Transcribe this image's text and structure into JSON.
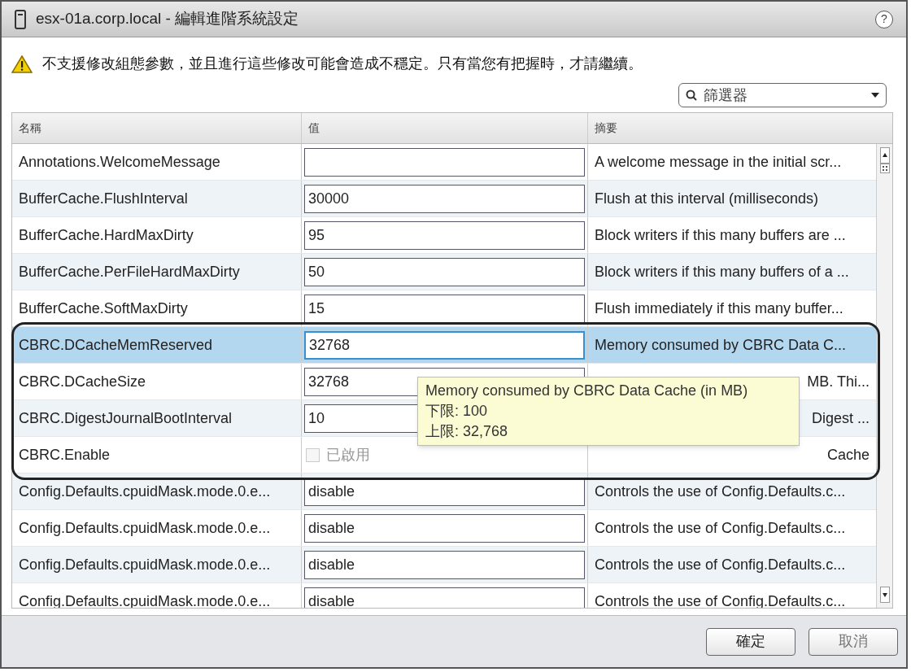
{
  "window": {
    "title": "esx-01a.corp.local - 編輯進階系統設定",
    "help": "?"
  },
  "warning": "不支援修改組態參數，並且進行這些修改可能會造成不穩定。只有當您有把握時，才請繼續。",
  "filter": {
    "placeholder": "篩選器"
  },
  "table": {
    "columns": [
      "名稱",
      "值",
      "摘要"
    ],
    "rows": [
      {
        "name": "Annotations.WelcomeMessage",
        "kind": "text",
        "value": "",
        "summary": "A welcome message in the initial scr...",
        "selected": false,
        "partial": false
      },
      {
        "name": "BufferCache.FlushInterval",
        "kind": "text",
        "value": "30000",
        "summary": "Flush at this interval (milliseconds)",
        "selected": false,
        "partial": false
      },
      {
        "name": "BufferCache.HardMaxDirty",
        "kind": "text",
        "value": "95",
        "summary": "Block writers if this many buffers are ...",
        "selected": false,
        "partial": false
      },
      {
        "name": "BufferCache.PerFileHardMaxDirty",
        "kind": "text",
        "value": "50",
        "summary": "Block writers if this many buffers of a ...",
        "selected": false,
        "partial": false
      },
      {
        "name": "BufferCache.SoftMaxDirty",
        "kind": "text",
        "value": "15",
        "summary": "Flush immediately if this many buffer...",
        "selected": false,
        "partial": false
      },
      {
        "name": "CBRC.DCacheMemReserved",
        "kind": "text",
        "value": "32768",
        "summary": "Memory consumed by CBRC Data C...",
        "selected": true,
        "partial": false
      },
      {
        "name": "CBRC.DCacheSize",
        "kind": "text",
        "value": "32768",
        "summary": "MB. Thi...",
        "selected": false,
        "partial": true
      },
      {
        "name": "CBRC.DigestJournalBootInterval",
        "kind": "text",
        "value": "10",
        "summary": "Digest ...",
        "selected": false,
        "partial": true
      },
      {
        "name": "CBRC.Enable",
        "kind": "checkbox",
        "value": "已啟用",
        "checked": false,
        "disabled": true,
        "summary": "Cache",
        "selected": false,
        "partial": true
      },
      {
        "name": "Config.Defaults.cpuidMask.mode.0.e...",
        "kind": "text",
        "value": "disable",
        "summary": "Controls the use of Config.Defaults.c...",
        "selected": false,
        "partial": false
      },
      {
        "name": "Config.Defaults.cpuidMask.mode.0.e...",
        "kind": "text",
        "value": "disable",
        "summary": "Controls the use of Config.Defaults.c...",
        "selected": false,
        "partial": false
      },
      {
        "name": "Config.Defaults.cpuidMask.mode.0.e...",
        "kind": "text",
        "value": "disable",
        "summary": "Controls the use of Config.Defaults.c...",
        "selected": false,
        "partial": false
      },
      {
        "name": "Config.Defaults.cpuidMask.mode.0.e...",
        "kind": "text",
        "value": "disable",
        "summary": "Controls the use of Config.Defaults.c...",
        "selected": false,
        "partial": false
      }
    ]
  },
  "tooltip": {
    "lines": [
      "Memory consumed by CBRC Data Cache (in MB)",
      "下限: 100",
      "上限: 32,768"
    ]
  },
  "buttons": [
    "確定",
    "取消"
  ]
}
